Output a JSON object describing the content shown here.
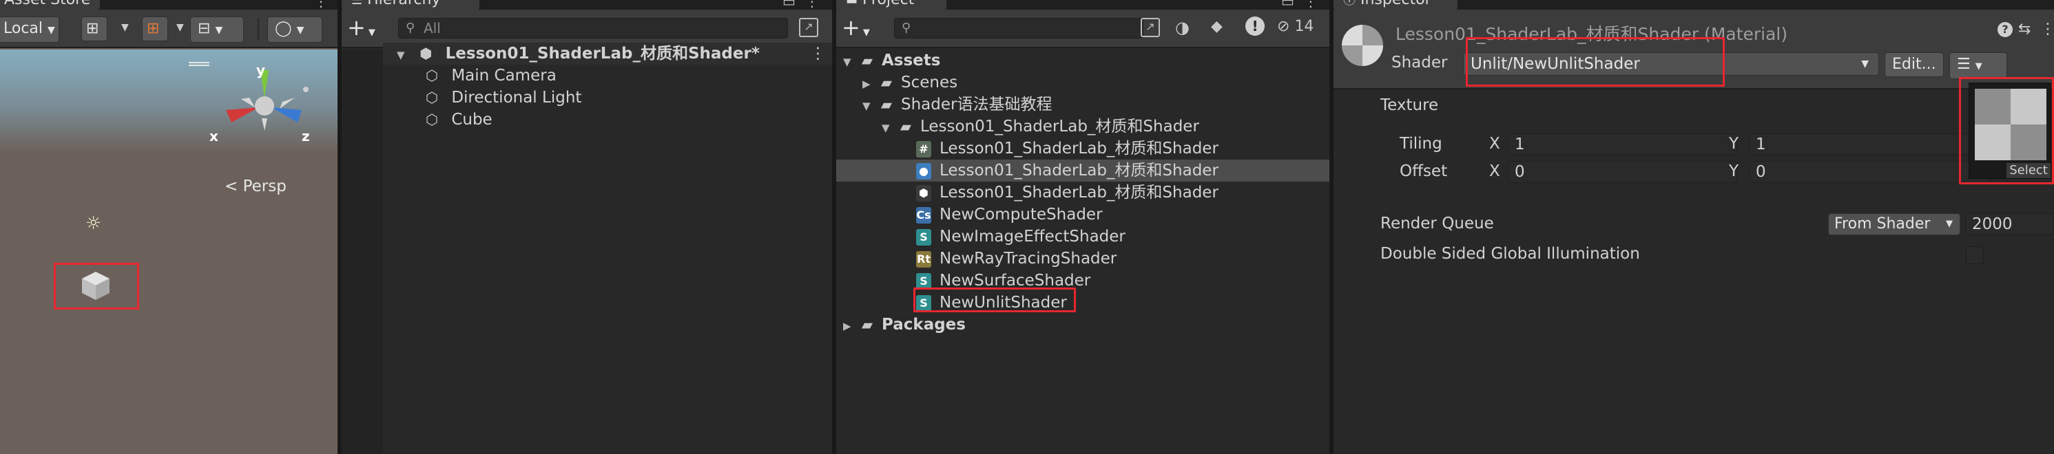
{
  "scene": {
    "tab_title": "Asset Store",
    "pivot_mode": "Local",
    "persp_label": "Persp",
    "axis_x": "x",
    "axis_y": "y",
    "axis_z": "z"
  },
  "hierarchy": {
    "tab_title": "Hierarchy",
    "add_label": "+",
    "search_placeholder": "All",
    "scene_name": "Lesson01_ShaderLab_材质和Shader*",
    "items": [
      {
        "label": "Main Camera",
        "icon": "cube-outline-icon"
      },
      {
        "label": "Directional Light",
        "icon": "cube-outline-icon"
      },
      {
        "label": "Cube",
        "icon": "cube-outline-icon"
      }
    ]
  },
  "project": {
    "tab_title": "Project",
    "add_label": "+",
    "hidden_count": "14",
    "tree": [
      {
        "label": "Assets",
        "depth": 0,
        "arrow": "▼",
        "icon": "folder-open-icon",
        "bold": true
      },
      {
        "label": "Scenes",
        "depth": 1,
        "arrow": "▶",
        "icon": "folder-icon"
      },
      {
        "label": "Shader语法基础教程",
        "depth": 1,
        "arrow": "▼",
        "icon": "folder-open-icon"
      },
      {
        "label": "Lesson01_ShaderLab_材质和Shader",
        "depth": 2,
        "arrow": "▼",
        "icon": "folder-open-icon"
      },
      {
        "label": "Lesson01_ShaderLab_材质和Shader",
        "depth": 3,
        "icon": "csharp-script-icon",
        "badge": "#",
        "badge_color": "#5a6a5a"
      },
      {
        "label": "Lesson01_ShaderLab_材质和Shader",
        "depth": 3,
        "icon": "material-sphere-icon",
        "badge": "●",
        "badge_color": "#3d7fbf",
        "selected": true
      },
      {
        "label": "Lesson01_ShaderLab_材质和Shader",
        "depth": 3,
        "icon": "unity-scene-icon",
        "badge": "⬢",
        "badge_color": "#3a3a3a"
      },
      {
        "label": "NewComputeShader",
        "depth": 3,
        "icon": "compute-shader-icon",
        "badge": "Cs",
        "badge_color": "#3b6fa8"
      },
      {
        "label": "NewImageEffectShader",
        "depth": 3,
        "icon": "shader-icon",
        "badge": "S",
        "badge_color": "#2f8f8f"
      },
      {
        "label": "NewRayTracingShader",
        "depth": 3,
        "icon": "raytracing-shader-icon",
        "badge": "Rt",
        "badge_color": "#8a7a3a"
      },
      {
        "label": "NewSurfaceShader",
        "depth": 3,
        "icon": "shader-icon",
        "badge": "S",
        "badge_color": "#2f8f8f"
      },
      {
        "label": "NewUnlitShader",
        "depth": 3,
        "icon": "shader-icon",
        "badge": "S",
        "badge_color": "#2f8f8f"
      },
      {
        "label": "Packages",
        "depth": 0,
        "arrow": "▶",
        "icon": "folder-icon",
        "bold": true
      }
    ]
  },
  "inspector": {
    "tab_title": "Inspector",
    "material_name": "Lesson01_ShaderLab_材质和Shader (Material)",
    "shader_label": "Shader",
    "shader_value": "Unlit/NewUnlitShader",
    "edit_label": "Edit...",
    "texture_label": "Texture",
    "tiling_label": "Tiling",
    "offset_label": "Offset",
    "x_label": "X",
    "y_label": "Y",
    "tiling_x": "1",
    "tiling_y": "1",
    "offset_x": "0",
    "offset_y": "0",
    "select_label": "Select",
    "render_queue_label": "Render Queue",
    "render_queue_mode": "From Shader",
    "render_queue_value": "2000",
    "dsgi_label": "Double Sided Global Illumination"
  },
  "colors": {
    "highlight_red": "#e8262f",
    "panel_bg": "#282828",
    "selected_row": "#4d4d4d"
  }
}
